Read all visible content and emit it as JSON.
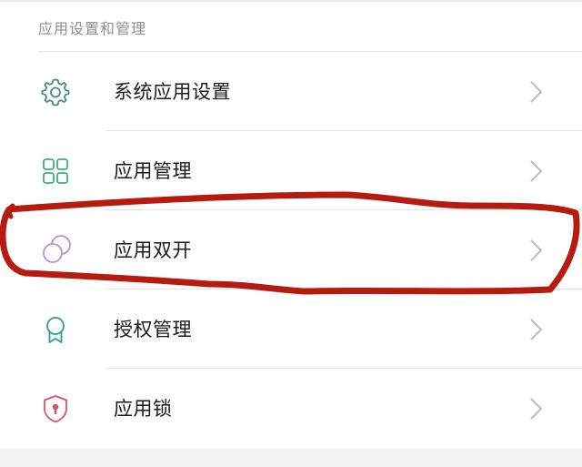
{
  "section": {
    "header": "应用设置和管理"
  },
  "items": [
    {
      "label": "系统应用设置",
      "icon": "gear-icon"
    },
    {
      "label": "应用管理",
      "icon": "grid-icon"
    },
    {
      "label": "应用双开",
      "icon": "dual-circle-icon"
    },
    {
      "label": "授权管理",
      "icon": "badge-icon"
    },
    {
      "label": "应用锁",
      "icon": "shield-lock-icon"
    }
  ],
  "colors": {
    "gear_icon": "#4a8a86",
    "grid_icon": "#3fae7c",
    "dual_circle_icon": "#b393d8",
    "badge_icon": "#2f9c88",
    "shield_icon": "#d8526a",
    "chevron": "#bdbdbd",
    "annotation": "#b51b10"
  }
}
